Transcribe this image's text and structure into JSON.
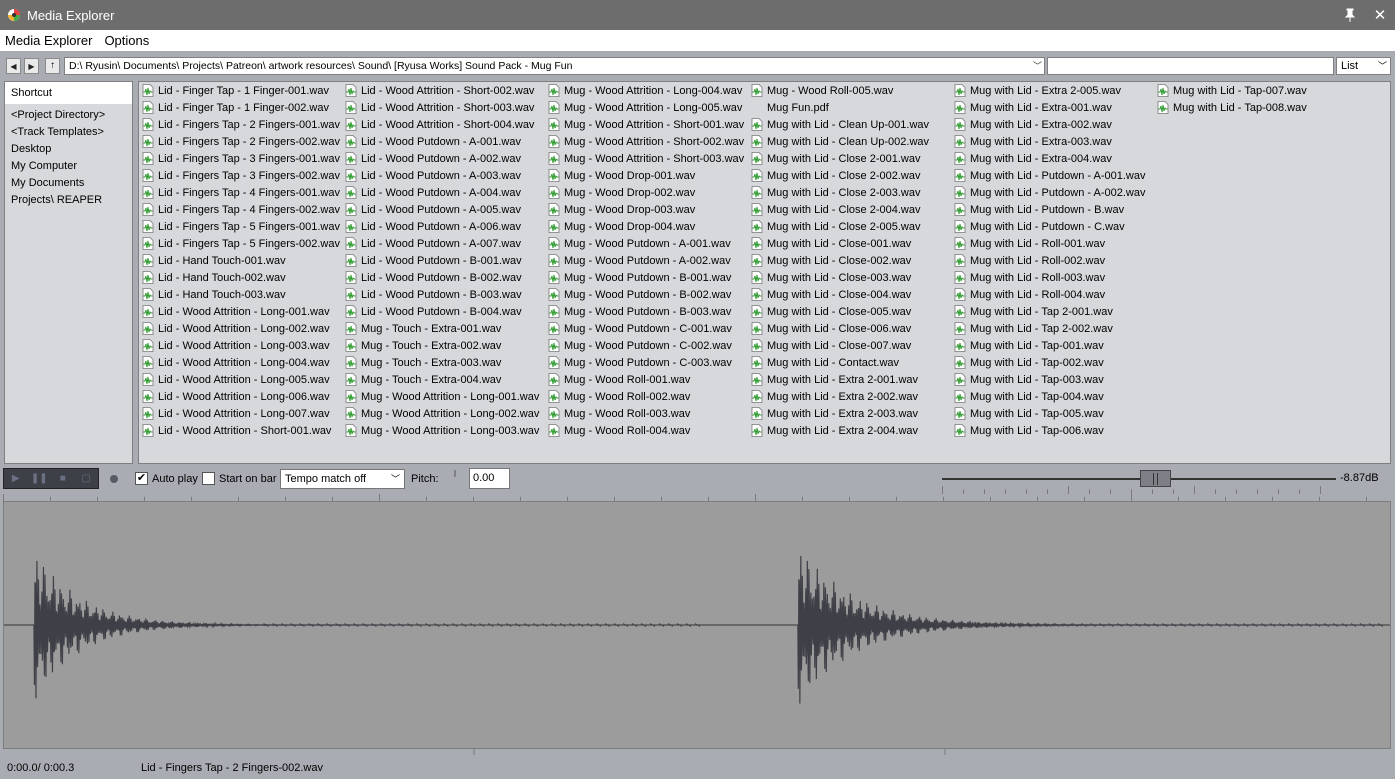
{
  "window": {
    "title": "Media Explorer"
  },
  "menu": {
    "items": [
      "Media Explorer",
      "Options"
    ]
  },
  "pathbar": {
    "path": "D:\\ Ryusin\\ Documents\\ Projects\\ Patreon\\ artwork resources\\ Sound\\ [Ryusa Works] Sound Pack - Mug Fun",
    "search_value": "",
    "view_mode": "List"
  },
  "sidebar": {
    "items": [
      "Shortcut",
      "<Project Directory>",
      "<Track Templates>",
      "Desktop",
      "My Computer",
      "My Documents",
      "Projects\\ REAPER"
    ]
  },
  "files": [
    [
      "Lid - Finger Tap - 1 Finger-001.wav",
      "Lid - Finger Tap - 1 Finger-002.wav",
      "Lid - Fingers Tap - 2 Fingers-001.wav",
      "Lid - Fingers Tap - 2 Fingers-002.wav",
      "Lid - Fingers Tap - 3 Fingers-001.wav",
      "Lid - Fingers Tap - 3 Fingers-002.wav",
      "Lid - Fingers Tap - 4 Fingers-001.wav",
      "Lid - Fingers Tap - 4 Fingers-002.wav",
      "Lid - Fingers Tap - 5 Fingers-001.wav",
      "Lid - Fingers Tap - 5 Fingers-002.wav",
      "Lid - Hand Touch-001.wav",
      "Lid - Hand Touch-002.wav",
      "Lid - Hand Touch-003.wav",
      "Lid - Wood Attrition - Long-001.wav",
      "Lid - Wood Attrition - Long-002.wav",
      "Lid - Wood Attrition - Long-003.wav",
      "Lid - Wood Attrition - Long-004.wav",
      "Lid - Wood Attrition - Long-005.wav",
      "Lid - Wood Attrition - Long-006.wav",
      "Lid - Wood Attrition - Long-007.wav",
      "Lid - Wood Attrition - Short-001.wav"
    ],
    [
      "Lid - Wood Attrition - Short-002.wav",
      "Lid - Wood Attrition - Short-003.wav",
      "Lid - Wood Attrition - Short-004.wav",
      "Lid - Wood Putdown - A-001.wav",
      "Lid - Wood Putdown - A-002.wav",
      "Lid - Wood Putdown - A-003.wav",
      "Lid - Wood Putdown - A-004.wav",
      "Lid - Wood Putdown - A-005.wav",
      "Lid - Wood Putdown - A-006.wav",
      "Lid - Wood Putdown - A-007.wav",
      "Lid - Wood Putdown - B-001.wav",
      "Lid - Wood Putdown - B-002.wav",
      "Lid - Wood Putdown - B-003.wav",
      "Lid - Wood Putdown - B-004.wav",
      "Mug - Touch - Extra-001.wav",
      "Mug - Touch - Extra-002.wav",
      "Mug - Touch - Extra-003.wav",
      "Mug - Touch - Extra-004.wav",
      "Mug - Wood Attrition - Long-001.wav",
      "Mug - Wood Attrition - Long-002.wav",
      "Mug - Wood Attrition - Long-003.wav"
    ],
    [
      "Mug - Wood Attrition - Long-004.wav",
      "Mug - Wood Attrition - Long-005.wav",
      "Mug - Wood Attrition - Short-001.wav",
      "Mug - Wood Attrition - Short-002.wav",
      "Mug - Wood Attrition - Short-003.wav",
      "Mug - Wood Drop-001.wav",
      "Mug - Wood Drop-002.wav",
      "Mug - Wood Drop-003.wav",
      "Mug - Wood Drop-004.wav",
      "Mug - Wood Putdown - A-001.wav",
      "Mug - Wood Putdown - A-002.wav",
      "Mug - Wood Putdown - B-001.wav",
      "Mug - Wood Putdown - B-002.wav",
      "Mug - Wood Putdown - B-003.wav",
      "Mug - Wood Putdown - C-001.wav",
      "Mug - Wood Putdown - C-002.wav",
      "Mug - Wood Putdown - C-003.wav",
      "Mug - Wood Roll-001.wav",
      "Mug - Wood Roll-002.wav",
      "Mug - Wood Roll-003.wav",
      "Mug - Wood Roll-004.wav"
    ],
    [
      "Mug - Wood Roll-005.wav",
      "Mug Fun.pdf",
      "Mug with Lid - Clean Up-001.wav",
      "Mug with Lid - Clean Up-002.wav",
      "Mug with Lid - Close 2-001.wav",
      "Mug with Lid - Close 2-002.wav",
      "Mug with Lid - Close 2-003.wav",
      "Mug with Lid - Close 2-004.wav",
      "Mug with Lid - Close 2-005.wav",
      "Mug with Lid - Close-001.wav",
      "Mug with Lid - Close-002.wav",
      "Mug with Lid - Close-003.wav",
      "Mug with Lid - Close-004.wav",
      "Mug with Lid - Close-005.wav",
      "Mug with Lid - Close-006.wav",
      "Mug with Lid - Close-007.wav",
      "Mug with Lid - Contact.wav",
      "Mug with Lid - Extra 2-001.wav",
      "Mug with Lid - Extra 2-002.wav",
      "Mug with Lid - Extra 2-003.wav",
      "Mug with Lid - Extra 2-004.wav"
    ],
    [
      "Mug with Lid - Extra 2-005.wav",
      "Mug with Lid - Extra-001.wav",
      "Mug with Lid - Extra-002.wav",
      "Mug with Lid - Extra-003.wav",
      "Mug with Lid - Extra-004.wav",
      "Mug with Lid - Putdown - A-001.wav",
      "Mug with Lid - Putdown - A-002.wav",
      "Mug with Lid - Putdown - B.wav",
      "Mug with Lid - Putdown - C.wav",
      "Mug with Lid - Roll-001.wav",
      "Mug with Lid - Roll-002.wav",
      "Mug with Lid - Roll-003.wav",
      "Mug with Lid - Roll-004.wav",
      "Mug with Lid - Tap 2-001.wav",
      "Mug with Lid - Tap 2-002.wav",
      "Mug with Lid - Tap-001.wav",
      "Mug with Lid - Tap-002.wav",
      "Mug with Lid - Tap-003.wav",
      "Mug with Lid - Tap-004.wav",
      "Mug with Lid - Tap-005.wav",
      "Mug with Lid - Tap-006.wav"
    ],
    [
      "Mug with Lid - Tap-007.wav",
      "Mug with Lid - Tap-008.wav"
    ]
  ],
  "transport": {
    "autoplay_label": "Auto play",
    "autoplay_checked": true,
    "start_on_bar_label": "Start on bar",
    "start_on_bar_checked": false,
    "tempo_match": "Tempo match off",
    "pitch_label": "Pitch:",
    "pitch_value": "0.00",
    "volume_db": "-8.87dB",
    "volume_level": 0.54
  },
  "status": {
    "time": "0:00.0/ 0:00.3",
    "selected_file": "Lid - Fingers Tap - 2 Fingers-002.wav"
  },
  "colors": {
    "titlebar": "#6d6d6d",
    "panel": "#d7d8dc",
    "background": "#a9acb2",
    "waveform_bg": "#9c9c9c",
    "waveform": "#3f4047",
    "audio_icon": "#2f9a2f"
  }
}
